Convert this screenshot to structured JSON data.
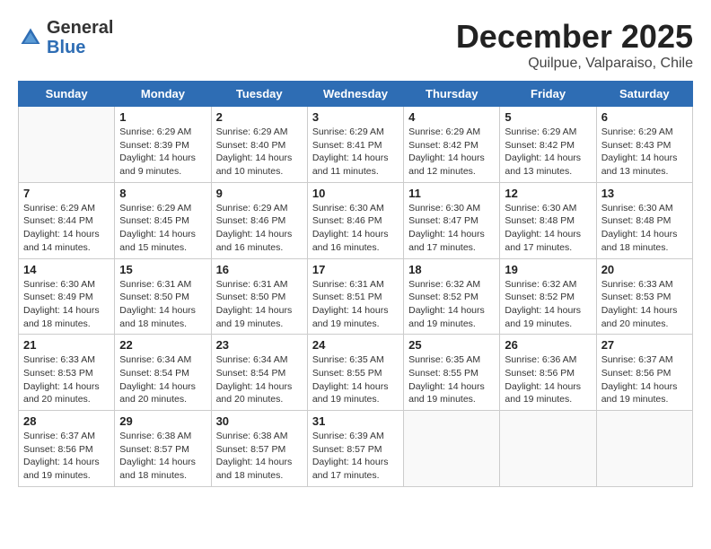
{
  "header": {
    "logo_general": "General",
    "logo_blue": "Blue",
    "month_title": "December 2025",
    "subtitle": "Quilpue, Valparaiso, Chile"
  },
  "weekdays": [
    "Sunday",
    "Monday",
    "Tuesday",
    "Wednesday",
    "Thursday",
    "Friday",
    "Saturday"
  ],
  "weeks": [
    [
      {
        "day": "",
        "info": ""
      },
      {
        "day": "1",
        "info": "Sunrise: 6:29 AM\nSunset: 8:39 PM\nDaylight: 14 hours\nand 9 minutes."
      },
      {
        "day": "2",
        "info": "Sunrise: 6:29 AM\nSunset: 8:40 PM\nDaylight: 14 hours\nand 10 minutes."
      },
      {
        "day": "3",
        "info": "Sunrise: 6:29 AM\nSunset: 8:41 PM\nDaylight: 14 hours\nand 11 minutes."
      },
      {
        "day": "4",
        "info": "Sunrise: 6:29 AM\nSunset: 8:42 PM\nDaylight: 14 hours\nand 12 minutes."
      },
      {
        "day": "5",
        "info": "Sunrise: 6:29 AM\nSunset: 8:42 PM\nDaylight: 14 hours\nand 13 minutes."
      },
      {
        "day": "6",
        "info": "Sunrise: 6:29 AM\nSunset: 8:43 PM\nDaylight: 14 hours\nand 13 minutes."
      }
    ],
    [
      {
        "day": "7",
        "info": "Sunrise: 6:29 AM\nSunset: 8:44 PM\nDaylight: 14 hours\nand 14 minutes."
      },
      {
        "day": "8",
        "info": "Sunrise: 6:29 AM\nSunset: 8:45 PM\nDaylight: 14 hours\nand 15 minutes."
      },
      {
        "day": "9",
        "info": "Sunrise: 6:29 AM\nSunset: 8:46 PM\nDaylight: 14 hours\nand 16 minutes."
      },
      {
        "day": "10",
        "info": "Sunrise: 6:30 AM\nSunset: 8:46 PM\nDaylight: 14 hours\nand 16 minutes."
      },
      {
        "day": "11",
        "info": "Sunrise: 6:30 AM\nSunset: 8:47 PM\nDaylight: 14 hours\nand 17 minutes."
      },
      {
        "day": "12",
        "info": "Sunrise: 6:30 AM\nSunset: 8:48 PM\nDaylight: 14 hours\nand 17 minutes."
      },
      {
        "day": "13",
        "info": "Sunrise: 6:30 AM\nSunset: 8:48 PM\nDaylight: 14 hours\nand 18 minutes."
      }
    ],
    [
      {
        "day": "14",
        "info": "Sunrise: 6:30 AM\nSunset: 8:49 PM\nDaylight: 14 hours\nand 18 minutes."
      },
      {
        "day": "15",
        "info": "Sunrise: 6:31 AM\nSunset: 8:50 PM\nDaylight: 14 hours\nand 18 minutes."
      },
      {
        "day": "16",
        "info": "Sunrise: 6:31 AM\nSunset: 8:50 PM\nDaylight: 14 hours\nand 19 minutes."
      },
      {
        "day": "17",
        "info": "Sunrise: 6:31 AM\nSunset: 8:51 PM\nDaylight: 14 hours\nand 19 minutes."
      },
      {
        "day": "18",
        "info": "Sunrise: 6:32 AM\nSunset: 8:52 PM\nDaylight: 14 hours\nand 19 minutes."
      },
      {
        "day": "19",
        "info": "Sunrise: 6:32 AM\nSunset: 8:52 PM\nDaylight: 14 hours\nand 19 minutes."
      },
      {
        "day": "20",
        "info": "Sunrise: 6:33 AM\nSunset: 8:53 PM\nDaylight: 14 hours\nand 20 minutes."
      }
    ],
    [
      {
        "day": "21",
        "info": "Sunrise: 6:33 AM\nSunset: 8:53 PM\nDaylight: 14 hours\nand 20 minutes."
      },
      {
        "day": "22",
        "info": "Sunrise: 6:34 AM\nSunset: 8:54 PM\nDaylight: 14 hours\nand 20 minutes."
      },
      {
        "day": "23",
        "info": "Sunrise: 6:34 AM\nSunset: 8:54 PM\nDaylight: 14 hours\nand 20 minutes."
      },
      {
        "day": "24",
        "info": "Sunrise: 6:35 AM\nSunset: 8:55 PM\nDaylight: 14 hours\nand 19 minutes."
      },
      {
        "day": "25",
        "info": "Sunrise: 6:35 AM\nSunset: 8:55 PM\nDaylight: 14 hours\nand 19 minutes."
      },
      {
        "day": "26",
        "info": "Sunrise: 6:36 AM\nSunset: 8:56 PM\nDaylight: 14 hours\nand 19 minutes."
      },
      {
        "day": "27",
        "info": "Sunrise: 6:37 AM\nSunset: 8:56 PM\nDaylight: 14 hours\nand 19 minutes."
      }
    ],
    [
      {
        "day": "28",
        "info": "Sunrise: 6:37 AM\nSunset: 8:56 PM\nDaylight: 14 hours\nand 19 minutes."
      },
      {
        "day": "29",
        "info": "Sunrise: 6:38 AM\nSunset: 8:57 PM\nDaylight: 14 hours\nand 18 minutes."
      },
      {
        "day": "30",
        "info": "Sunrise: 6:38 AM\nSunset: 8:57 PM\nDaylight: 14 hours\nand 18 minutes."
      },
      {
        "day": "31",
        "info": "Sunrise: 6:39 AM\nSunset: 8:57 PM\nDaylight: 14 hours\nand 17 minutes."
      },
      {
        "day": "",
        "info": ""
      },
      {
        "day": "",
        "info": ""
      },
      {
        "day": "",
        "info": ""
      }
    ]
  ]
}
